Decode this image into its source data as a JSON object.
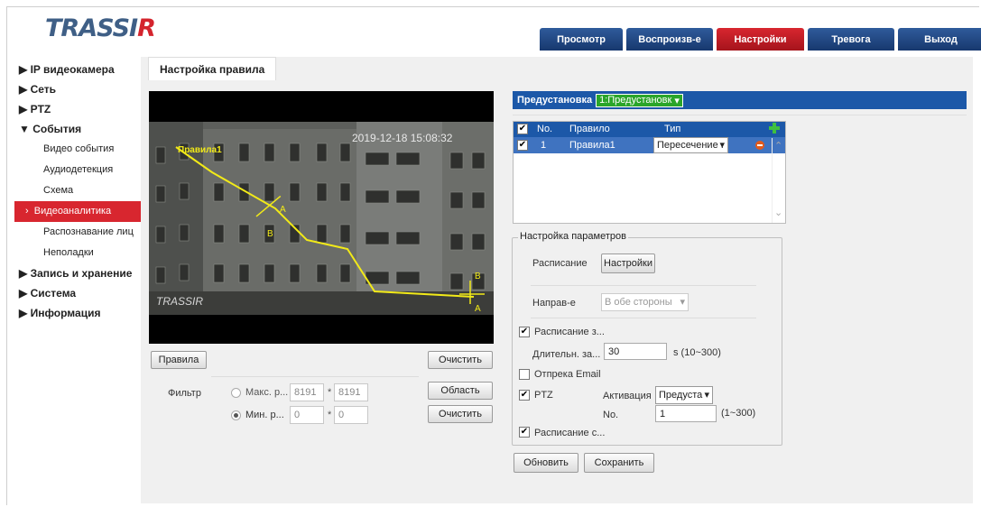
{
  "logo": {
    "text_main": "TRASSI",
    "text_accent": "R"
  },
  "tabs": [
    {
      "label": "Просмотр",
      "active": false
    },
    {
      "label": "Воспроизв-е",
      "active": false
    },
    {
      "label": "Настройки",
      "active": true
    },
    {
      "label": "Тревога",
      "active": false
    },
    {
      "label": "Выход",
      "active": false
    }
  ],
  "sidebar": {
    "ip_camera": "IP видеокамера",
    "network": "Сеть",
    "ptz": "PTZ",
    "events": "События",
    "video_events": "Видео события",
    "audio_detection": "Аудиодетекция",
    "scheme": "Схема",
    "video_analytics": "Видеоаналитика",
    "face_recognition": "Распознавание лиц",
    "faults": "Неполадки",
    "recording": "Запись и хранение",
    "system": "Система",
    "info": "Информация"
  },
  "page_tab": "Настройка правила",
  "video": {
    "timestamp": "2019-12-18 15:08:32",
    "watermark": "TRASSIR",
    "line_label": "Правила1",
    "mark_a": "A",
    "mark_b": "B"
  },
  "left_controls": {
    "rules_button": "Правила",
    "clear_button": "Очистить",
    "filter_label": "Фильтр",
    "max_label": "Макс. р...",
    "max_w": "8191",
    "max_h": "8191",
    "min_label": "Мин. р...",
    "min_w": "0",
    "min_h": "0",
    "times": "*",
    "area_button": "Область",
    "clear2_button": "Очистить"
  },
  "preset": {
    "label": "Предустановка",
    "value": "1:Предустановк"
  },
  "rules_table": {
    "col_no": "No.",
    "col_rule": "Правило",
    "col_type": "Тип",
    "row": {
      "no": "1",
      "rule": "Правила1",
      "type": "Пересечение ."
    }
  },
  "params": {
    "title": "Настройка параметров",
    "schedule_label": "Расписание",
    "schedule_button": "Настройки",
    "direction_label": "Направ-е",
    "direction_value": "В обе стороны",
    "schedule_check": "Расписание з...",
    "duration_label": "Длительн. за...",
    "duration_value": "30",
    "duration_range": "s (10~300)",
    "email_check": "Отпрека Email",
    "ptz_check": "PTZ",
    "activation_label": "Активация",
    "activation_value": "Предуста",
    "no_label": "No.",
    "no_value": "1",
    "no_range": "(1~300)",
    "schedule_check2": "Расписание с..."
  },
  "footer": {
    "refresh_button": "Обновить",
    "save_button": "Сохранить"
  }
}
